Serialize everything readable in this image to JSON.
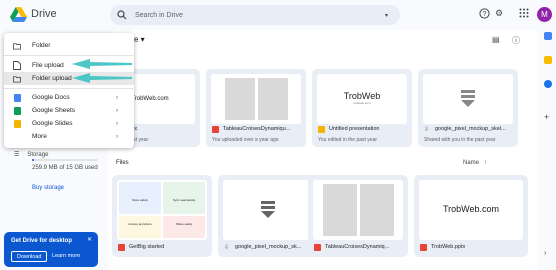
{
  "app": {
    "name": "Drive"
  },
  "search": {
    "placeholder": "Search in Drive"
  },
  "header": {
    "avatar_initial": "M"
  },
  "main": {
    "title_suffix": "e",
    "suggested_label": "ss",
    "files_label": "Files",
    "sort_label": "Name"
  },
  "menu": {
    "items": [
      {
        "label": "Folder"
      },
      {
        "label": "File upload"
      },
      {
        "label": "Folder upload"
      },
      {
        "label": "Google Docs"
      },
      {
        "label": "Google Sheets"
      },
      {
        "label": "Google Slides"
      },
      {
        "label": "More"
      }
    ]
  },
  "sidebar": {
    "storage_label": "Storage",
    "storage_text": "259.9 MB of 15 GB used",
    "storage_fraction": 0.017,
    "buy_storage": "Buy storage"
  },
  "promo": {
    "title": "Get Drive for desktop",
    "download": "Download",
    "learn_more": "Learn more"
  },
  "suggested": [
    {
      "thumb_text": "TrobWeb.com",
      "name": "Web.pptx",
      "sub": "in the past year"
    },
    {
      "name": "TableauCroisesDynamiqu...",
      "sub": "You uploaded over a year ago"
    },
    {
      "thumb_text": "TrobWeb",
      "thumb_small": "trobweb.com",
      "name": "Untitled presentation",
      "sub": "You edited in the past year"
    },
    {
      "name": "google_pixel_mockup_skel...",
      "sub": "Shared with you in the past year"
    }
  ],
  "files": [
    {
      "name": "GetBig started"
    },
    {
      "name": "google_pixel_mockup_sk..."
    },
    {
      "name": "TableauCroisesDynamiq..."
    },
    {
      "thumb_text": "TrobWeb.com",
      "name": "TrobWeb.pptx"
    }
  ],
  "files_thumb_captions": {
    "a": "Store safely",
    "b": "Sync seamlessly",
    "c": "Access anywhere",
    "d": "Share easily"
  },
  "colors": {
    "accent": "#0b57d0",
    "avatar": "#8e24aa",
    "doc_blue": "#4285f4",
    "sheets_green": "#0f9d58",
    "slides_yellow": "#f4b400",
    "pdf_red": "#ea4335",
    "pointer_arrow": "#4cc6c6"
  }
}
